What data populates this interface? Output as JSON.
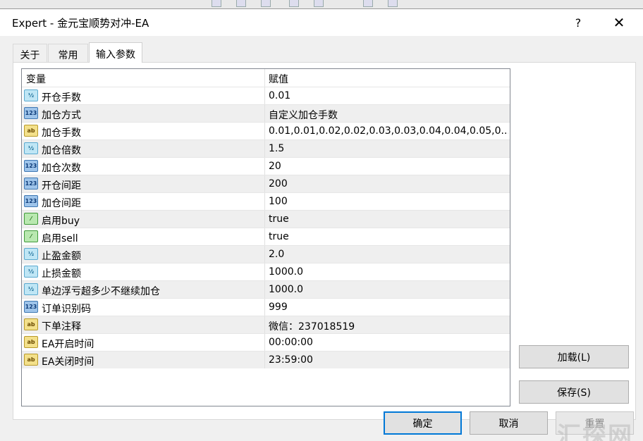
{
  "window": {
    "title": "Expert - 金元宝顺势对冲-EA",
    "help_label": "?",
    "close_label": "✕"
  },
  "tabs": [
    {
      "label": "关于"
    },
    {
      "label": "常用"
    },
    {
      "label": "输入参数"
    }
  ],
  "grid": {
    "columns": {
      "name": "变量",
      "value": "赋值"
    },
    "rows": [
      {
        "name": "开仓手数",
        "value": "0.01",
        "type": "double-icon"
      },
      {
        "name": "加仓方式",
        "value": "自定义加仓手数",
        "type": "int-icon"
      },
      {
        "name": "加仓手数",
        "value": "0.01,0.01,0.02,0.02,0.03,0.03,0.04,0.04,0.05,0...",
        "type": "string-icon"
      },
      {
        "name": "加仓倍数",
        "value": "1.5",
        "type": "double-icon"
      },
      {
        "name": "加仓次数",
        "value": "20",
        "type": "int-icon"
      },
      {
        "name": "开仓间距",
        "value": "200",
        "type": "int-icon"
      },
      {
        "name": "加仓间距",
        "value": "100",
        "type": "int-icon"
      },
      {
        "name": "启用buy",
        "value": "true",
        "type": "bool-icon"
      },
      {
        "name": "启用sell",
        "value": "true",
        "type": "bool-icon"
      },
      {
        "name": "止盈金额",
        "value": "2.0",
        "type": "double-icon"
      },
      {
        "name": "止损金额",
        "value": "1000.0",
        "type": "double-icon"
      },
      {
        "name": "单边浮亏超多少不继续加仓",
        "value": "1000.0",
        "type": "double-icon"
      },
      {
        "name": "订单识别码",
        "value": "999",
        "type": "int-icon"
      },
      {
        "name": "下单注释",
        "value": "微信：237018519",
        "type": "string-icon"
      },
      {
        "name": "EA开启时间",
        "value": "00:00:00",
        "type": "string-icon"
      },
      {
        "name": "EA关闭时间",
        "value": "23:59:00",
        "type": "string-icon"
      }
    ]
  },
  "icons": {
    "double": {
      "glyph": "½"
    },
    "int": {
      "glyph": "123"
    },
    "string": {
      "glyph": "ab"
    },
    "bool": {
      "glyph": "⁄"
    }
  },
  "buttons": {
    "load": "加载(L)",
    "save": "保存(S)",
    "ok": "确定",
    "cancel": "取消",
    "reset": "重置"
  },
  "watermark": "汇探网"
}
